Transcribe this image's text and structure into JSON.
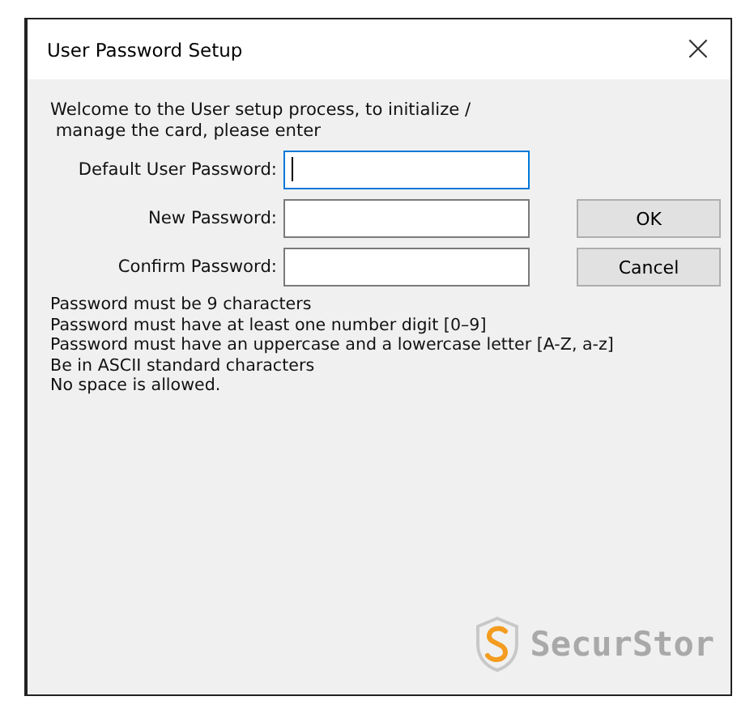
{
  "window": {
    "title": "User Password Setup",
    "close": "×"
  },
  "intro": "Welcome to the User setup process, to initialize /\n manage the card, please enter",
  "fields": [
    {
      "label": "Default User Password:",
      "focused": true
    },
    {
      "label": "New Password:",
      "focused": false
    },
    {
      "label": "Confirm Password:",
      "focused": false
    }
  ],
  "buttons": [
    {
      "label": "OK"
    },
    {
      "label": "Cancel"
    }
  ],
  "rules": [
    "Password must be 9 characters",
    "Password must have at least one number digit [0–9]",
    "Password must have an uppercase and a lowercase letter [A-Z, a-z]",
    "Be in ASCII standard characters",
    "No space is allowed."
  ],
  "logo": {
    "text": "SecurStor"
  }
}
